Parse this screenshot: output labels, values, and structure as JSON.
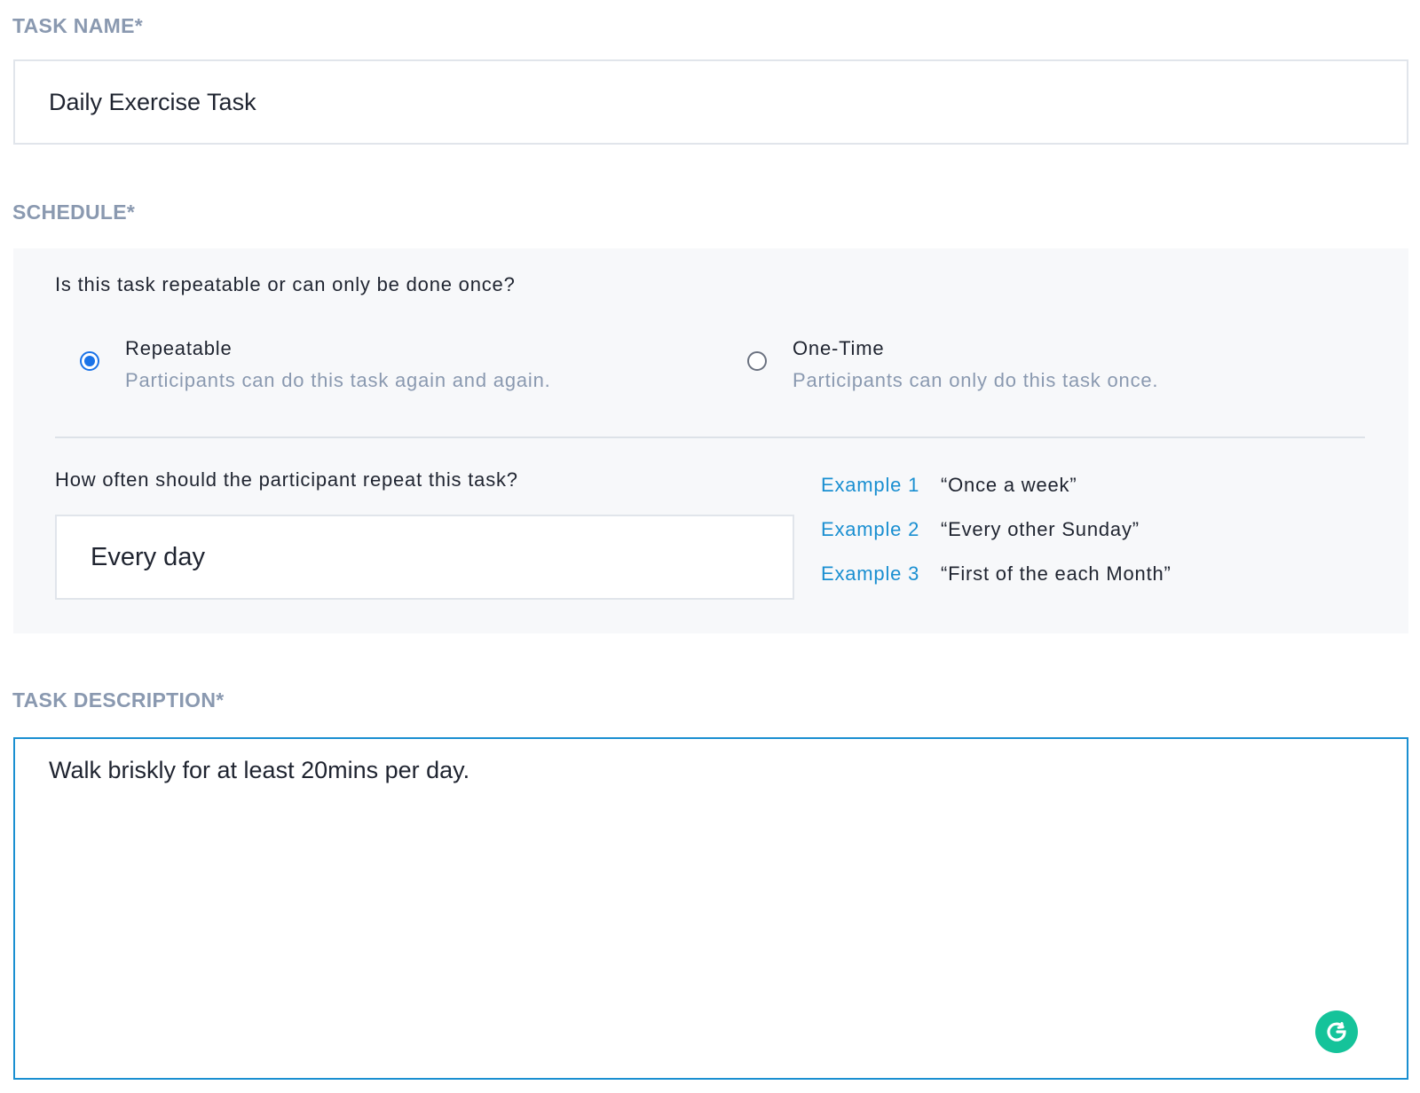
{
  "task_name": {
    "label": "TASK NAME*",
    "value": "Daily Exercise Task"
  },
  "schedule": {
    "label": "SCHEDULE*",
    "question": "Is this task repeatable or can only be done once?",
    "options": [
      {
        "title": "Repeatable",
        "description": "Participants can do this task again and again.",
        "selected": true
      },
      {
        "title": "One-Time",
        "description": "Participants can only do this task once.",
        "selected": false
      }
    ],
    "frequency_question": "How often should the participant repeat this task?",
    "frequency_value": "Every day",
    "examples": [
      {
        "label": "Example 1",
        "text": "“Once a week”"
      },
      {
        "label": "Example 2",
        "text": "“Every other Sunday”"
      },
      {
        "label": "Example 3",
        "text": "“First of the each Month”"
      }
    ]
  },
  "task_description": {
    "label": "TASK DESCRIPTION*",
    "value": "Walk briskly for at least 20mins per day."
  },
  "colors": {
    "label_gray": "#8a99b0",
    "accent_blue": "#1a73e8",
    "link_blue": "#1a8fd1",
    "grammarly_green": "#15c39a",
    "panel_bg": "#f7f8fa"
  },
  "icons": {
    "grammarly": "grammarly-icon"
  }
}
